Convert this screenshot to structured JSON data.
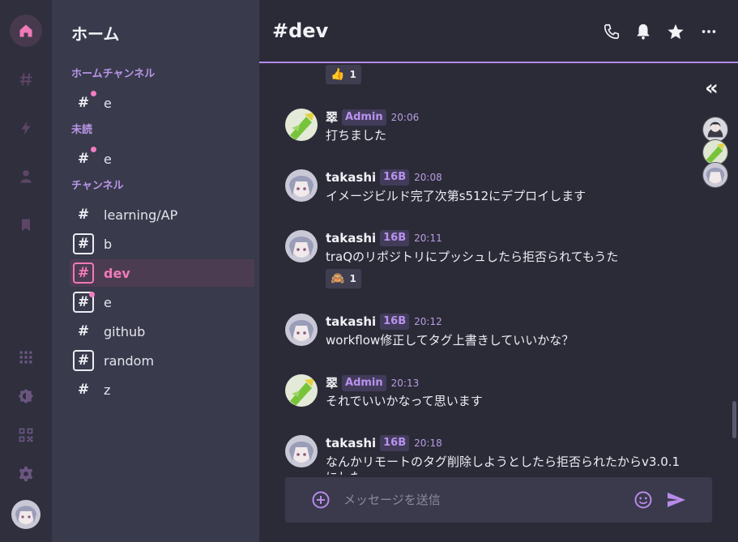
{
  "rail": {
    "items": [
      "home-icon",
      "hash-icon",
      "lightning-icon",
      "person-icon",
      "bookmark-icon"
    ],
    "bottom": [
      "apps-grid-icon",
      "theme-icon",
      "qr-code-icon",
      "settings-icon"
    ]
  },
  "sidebar": {
    "title": "ホーム",
    "sections": {
      "home": "ホームチャンネル",
      "unread": "未読",
      "channels": "チャンネル"
    },
    "home_channels": [
      {
        "name": "e"
      }
    ],
    "unread_channels": [
      {
        "name": "e"
      }
    ],
    "channels": [
      {
        "name": "learning/AP"
      },
      {
        "name": "b"
      },
      {
        "name": "dev"
      },
      {
        "name": "e"
      },
      {
        "name": "github"
      },
      {
        "name": "random"
      },
      {
        "name": "z"
      }
    ]
  },
  "header": {
    "hash": "#",
    "title": "dev"
  },
  "top_stamp": {
    "emoji": "👍",
    "count": "1"
  },
  "messages": [
    {
      "user": "翠",
      "grade": "Admin",
      "time": "20:06",
      "text": "打ちました"
    },
    {
      "user": "takashi",
      "grade": "16B",
      "time": "20:08",
      "text": "イメージビルド完了次第s512にデプロイします"
    },
    {
      "user": "takashi",
      "grade": "16B",
      "time": "20:11",
      "text": "traQのリポジトリにプッシュしたら拒否られてもうた",
      "stamp": {
        "emoji": "🙈",
        "count": "1"
      }
    },
    {
      "user": "takashi",
      "grade": "16B",
      "time": "20:12",
      "text": "workflow修正してタグ上書きしていいかな？"
    },
    {
      "user": "翠",
      "grade": "Admin",
      "time": "20:13",
      "text": "それでいいかなって思います"
    },
    {
      "user": "takashi",
      "grade": "16B",
      "time": "20:18",
      "text": "なんかリモートのタグ削除しようとしたら拒否られたからv3.0.1",
      "text2": "にした"
    }
  ],
  "input": {
    "placeholder": "メッセージを送信"
  },
  "colors": {
    "accent": "#b78ae8",
    "active": "#f07ab8",
    "unread_dot": "#f37cc0"
  }
}
